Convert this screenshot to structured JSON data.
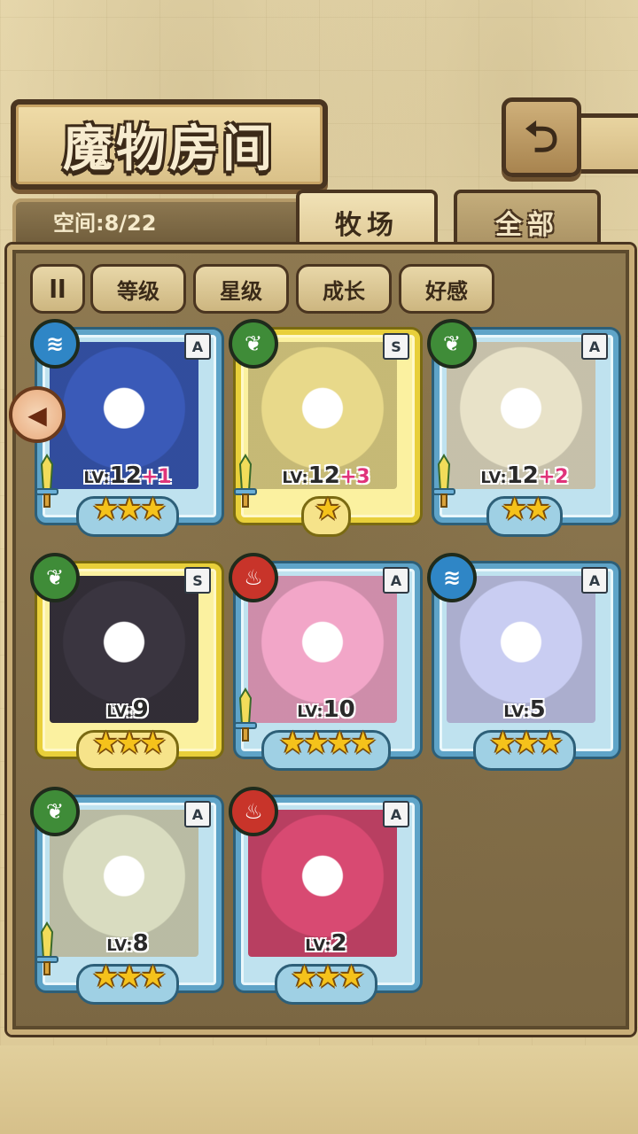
{
  "header": {
    "title": "魔物房间",
    "back_icon": "⮌"
  },
  "space": {
    "label": "空间:8/22"
  },
  "tabs": [
    {
      "label": "牧场",
      "active": true
    },
    {
      "label": "全部",
      "active": false
    }
  ],
  "filters": {
    "sort_icon": "ll",
    "items": [
      "等级",
      "星级",
      "成长",
      "好感"
    ]
  },
  "side_arrow": {
    "icon": "arrow-left-icon"
  },
  "cards": [
    {
      "rank": "A",
      "element": "water",
      "level": "12",
      "plus": "+1",
      "stars": "★★★",
      "frame": "blue",
      "has_sword": true
    },
    {
      "rank": "S",
      "element": "leaf",
      "level": "12",
      "plus": "+3",
      "stars": "★",
      "frame": "gold",
      "has_sword": true
    },
    {
      "rank": "A",
      "element": "leaf",
      "level": "12",
      "plus": "+2",
      "stars": "★★",
      "frame": "blue",
      "has_sword": true
    },
    {
      "rank": "S",
      "element": "leaf",
      "level": "9",
      "plus": "",
      "stars": "★★★",
      "frame": "gold",
      "has_sword": false
    },
    {
      "rank": "A",
      "element": "fire",
      "level": "10",
      "plus": "",
      "stars": "★★★★",
      "frame": "blue",
      "has_sword": true
    },
    {
      "rank": "A",
      "element": "water",
      "level": "5",
      "plus": "",
      "stars": "★★★",
      "frame": "blue",
      "has_sword": false
    },
    {
      "rank": "A",
      "element": "leaf",
      "level": "8",
      "plus": "",
      "stars": "★★★",
      "frame": "blue",
      "has_sword": true
    },
    {
      "rank": "A",
      "element": "fire",
      "level": "2",
      "plus": "",
      "stars": "★★★",
      "frame": "blue",
      "has_sword": false
    }
  ],
  "colors": {
    "water": "#2f86c6",
    "leaf": "#3f8c38",
    "fire": "#c8342a",
    "portraits": [
      "#3a5ab8",
      "#e8d98a",
      "#e8e2c8",
      "#3a3540",
      "#f2a6c8",
      "#c9cdf2",
      "#d9dcc0",
      "#d84a72"
    ]
  }
}
